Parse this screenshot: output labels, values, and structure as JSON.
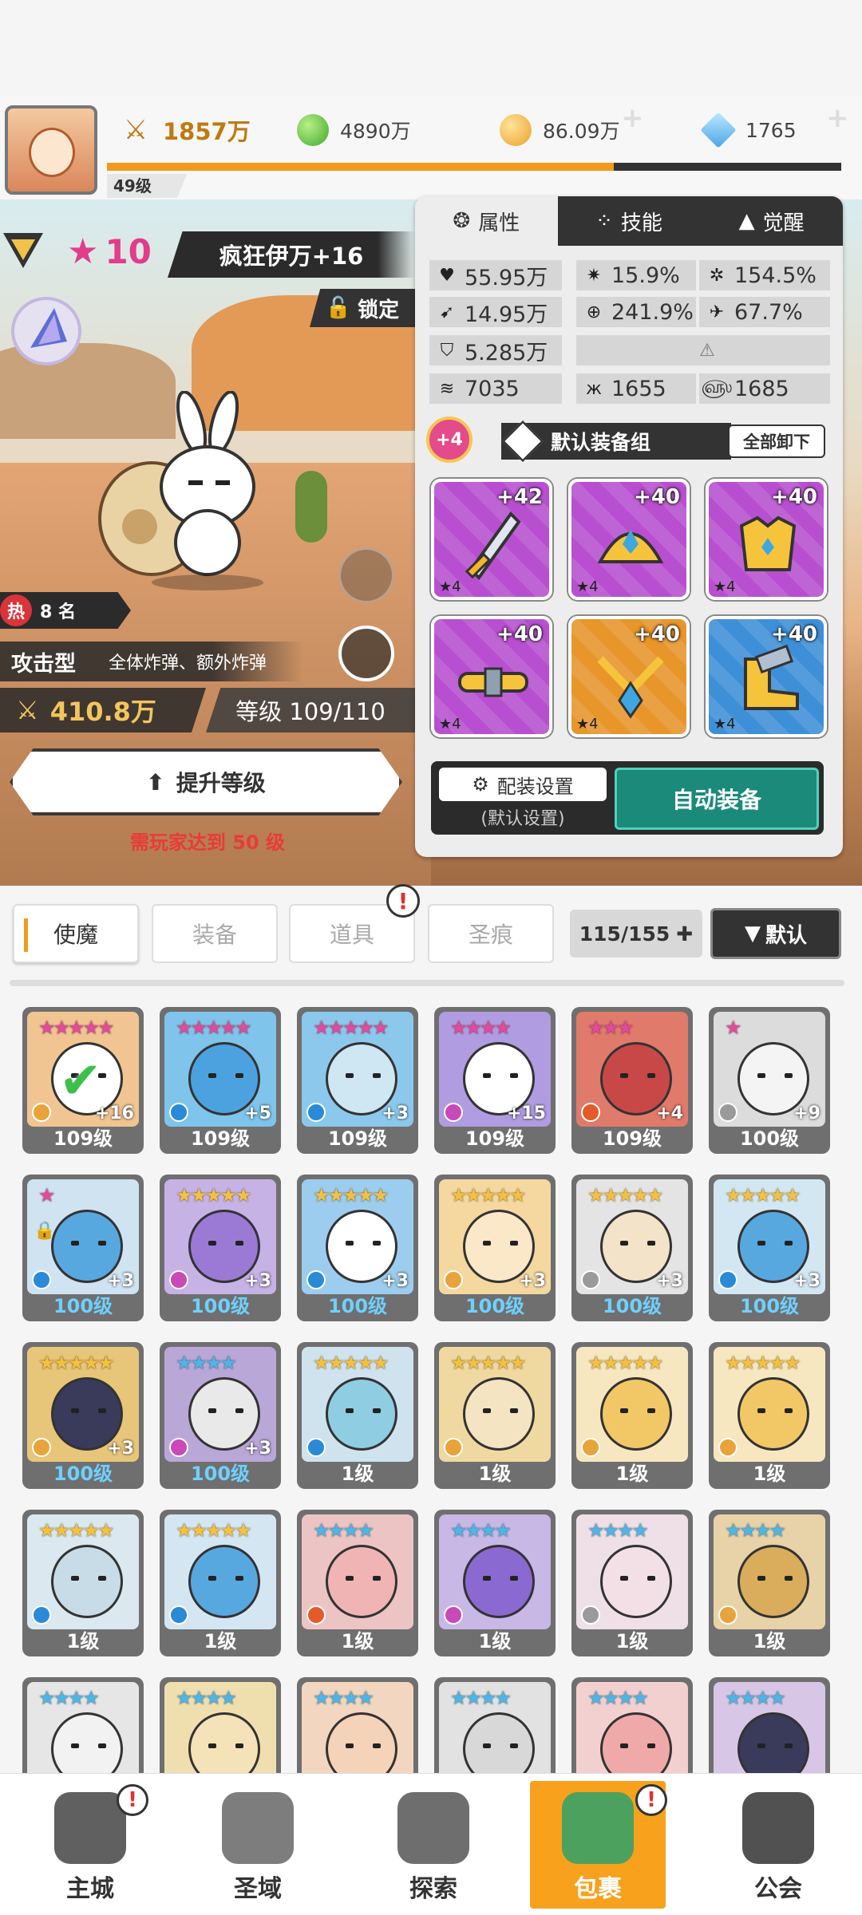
{
  "top": {
    "resources": [
      {
        "name": "power",
        "value": "1857万",
        "icon": "crossed-swords-icon"
      },
      {
        "name": "gold",
        "value": "4890万",
        "icon": "green-gem-icon"
      },
      {
        "name": "coin",
        "value": "86.09万",
        "icon": "gold-coin-icon"
      },
      {
        "name": "diamond",
        "value": "1765",
        "icon": "blue-crystal-icon"
      }
    ],
    "level": "49级",
    "xp_fraction": 0.69
  },
  "hero": {
    "star_count": "10",
    "name": "疯狂伊万+16",
    "lock_label": "锁定",
    "hot_label": "热",
    "hot_rank": "8 名",
    "type": "攻击型",
    "type_desc": "全体炸弹、额外炸弹",
    "power": "410.8万",
    "level": "等级 109/110",
    "upgrade_label": "提升等级",
    "requirement": "需玩家达到 50 级"
  },
  "panel": {
    "tabs": [
      "属性",
      "技能",
      "觉醒"
    ],
    "stats": [
      {
        "icon": "heart-icon",
        "value": "55.95万"
      },
      {
        "icon": "crit-icon",
        "value": "15.9%"
      },
      {
        "icon": "critdmg-icon",
        "value": "154.5%"
      },
      {
        "icon": "attack-icon",
        "value": "14.95万"
      },
      {
        "icon": "target-icon",
        "value": "241.9%"
      },
      {
        "icon": "speed-icon",
        "value": "67.7%"
      },
      {
        "icon": "shield-icon",
        "value": "5.285万"
      },
      {
        "icon": "wind-icon",
        "value": "7035"
      },
      {
        "icon": "dodge-icon",
        "value": "1655"
      },
      {
        "icon": "swirl-icon",
        "value": "1685"
      }
    ],
    "equip_badge": "+4",
    "equip_set": "默认装备组",
    "unequip_all": "全部卸下",
    "equipment": [
      {
        "plus": "+42",
        "stars": "★4",
        "kind": "sword",
        "color": "#b84fd0"
      },
      {
        "plus": "+40",
        "stars": "★4",
        "kind": "helmet",
        "color": "#b84fd0"
      },
      {
        "plus": "+40",
        "stars": "★4",
        "kind": "armor",
        "color": "#b84fd0"
      },
      {
        "plus": "+40",
        "stars": "★4",
        "kind": "belt",
        "color": "#b84fd0"
      },
      {
        "plus": "+40",
        "stars": "★4",
        "kind": "necklace",
        "color": "#e8952a"
      },
      {
        "plus": "+40",
        "stars": "★4",
        "kind": "boots",
        "color": "#3d8fd8"
      }
    ],
    "config_label": "配装设置",
    "config_sub": "(默认设置)",
    "auto_label": "自动装备"
  },
  "filter": {
    "tabs": [
      "使魔",
      "装备",
      "道具",
      "圣痕"
    ],
    "capacity": "115/155",
    "sort_label": "默认"
  },
  "cards": [
    {
      "stars": "★★★★★",
      "star_color": "#e6489a",
      "level": "109级",
      "plus": "+16",
      "bg": "#f1c591",
      "face": "#ffffff",
      "elem": "#e8a43a",
      "check": true
    },
    {
      "stars": "★★★★★",
      "star_color": "#e6489a",
      "level": "109级",
      "plus": "+5",
      "bg": "#7fc4ea",
      "face": "#4ca2de",
      "elem": "#2a8ad8"
    },
    {
      "stars": "★★★★★",
      "star_color": "#e6489a",
      "level": "109级",
      "plus": "+3",
      "bg": "#8cc8ec",
      "face": "#cfe6f3",
      "elem": "#2a8ad8"
    },
    {
      "stars": "★★★★",
      "star_color": "#e6489a",
      "level": "109级",
      "plus": "+15",
      "bg": "#b09ce0",
      "face": "#ffffff",
      "elem": "#c84ab8"
    },
    {
      "stars": "★★★",
      "star_color": "#e6489a",
      "level": "109级",
      "plus": "+4",
      "bg": "#e07a6a",
      "face": "#c84848",
      "elem": "#e55a2a"
    },
    {
      "stars": "★",
      "star_color": "#e6489a",
      "level": "100级",
      "plus": "+9",
      "bg": "#dcdcdc",
      "face": "#f4f4f4",
      "elem": "#9a9a9a"
    },
    {
      "stars": "★",
      "star_color": "#e6489a",
      "level": "100级",
      "plus": "+3",
      "bg": "#cfe3f0",
      "face": "#58a8e0",
      "elem": "#2a8ad8",
      "blue": true,
      "lock": true
    },
    {
      "stars": "★★★★★",
      "star_color": "#f6c13a",
      "level": "100级",
      "plus": "+3",
      "bg": "#c7b2e6",
      "face": "#9b7ad6",
      "elem": "#c84ab8",
      "blue": true
    },
    {
      "stars": "★★★★★",
      "star_color": "#f6c13a",
      "level": "100级",
      "plus": "+3",
      "bg": "#9ccdef",
      "face": "#ffffff",
      "elem": "#2a8ad8",
      "blue": true
    },
    {
      "stars": "★★★★★",
      "star_color": "#f6c13a",
      "level": "100级",
      "plus": "+3",
      "bg": "#f4d8a0",
      "face": "#fbe8c8",
      "elem": "#e8a43a",
      "blue": true
    },
    {
      "stars": "★★★★★",
      "star_color": "#f6c13a",
      "level": "100级",
      "plus": "+3",
      "bg": "#e4e4e4",
      "face": "#f3e3c8",
      "elem": "#9a9a9a",
      "blue": true
    },
    {
      "stars": "★★★★★",
      "star_color": "#f6c13a",
      "level": "100级",
      "plus": "+3",
      "bg": "#d3e7f3",
      "face": "#58a8e0",
      "elem": "#2a8ad8",
      "blue": true
    },
    {
      "stars": "★★★★★",
      "star_color": "#f6c13a",
      "level": "100级",
      "plus": "+3",
      "bg": "#e7c67a",
      "face": "#3a3b5a",
      "elem": "#e8a43a",
      "blue": true
    },
    {
      "stars": "★★★★",
      "star_color": "#4cb6e8",
      "level": "100级",
      "plus": "+3",
      "bg": "#b9a7d8",
      "face": "#e9e9e9",
      "elem": "#c84ab8",
      "blue": true
    },
    {
      "stars": "★★★★★",
      "star_color": "#f6c13a",
      "level": "1级",
      "plus": "",
      "bg": "#cfe3ef",
      "face": "#8fcde2",
      "elem": "#2a8ad8"
    },
    {
      "stars": "★★★★★",
      "star_color": "#f6c13a",
      "level": "1级",
      "plus": "",
      "bg": "#f0d9a0",
      "face": "#f4e4c2",
      "elem": "#e8a43a"
    },
    {
      "stars": "★★★★★",
      "star_color": "#f6c13a",
      "level": "1级",
      "plus": "",
      "bg": "#f6e7c0",
      "face": "#f2c866",
      "elem": "#e8a43a"
    },
    {
      "stars": "★★★★★",
      "star_color": "#f6c13a",
      "level": "1级",
      "plus": "",
      "bg": "#f6e7c0",
      "face": "#f2c866",
      "elem": "#e8a43a"
    },
    {
      "stars": "★★★★★",
      "star_color": "#f6c13a",
      "level": "1级",
      "plus": "",
      "bg": "#dbe8ef",
      "face": "#c7dce6",
      "elem": "#2a8ad8"
    },
    {
      "stars": "★★★★★",
      "star_color": "#f6c13a",
      "level": "1级",
      "plus": "",
      "bg": "#d5e6f3",
      "face": "#58a8e0",
      "elem": "#2a8ad8"
    },
    {
      "stars": "★★★★",
      "star_color": "#4cb6e8",
      "level": "1级",
      "plus": "",
      "bg": "#ecc4c4",
      "face": "#f0b4b4",
      "elem": "#e55a2a"
    },
    {
      "stars": "★★★★",
      "star_color": "#4cb6e8",
      "level": "1级",
      "plus": "",
      "bg": "#c7b8e6",
      "face": "#8a6ad0",
      "elem": "#c84ab8"
    },
    {
      "stars": "★★★★",
      "star_color": "#4cb6e8",
      "level": "1级",
      "plus": "",
      "bg": "#efe0e8",
      "face": "#f3e0e6",
      "elem": "#9a9a9a"
    },
    {
      "stars": "★★★★",
      "star_color": "#4cb6e8",
      "level": "1级",
      "plus": "",
      "bg": "#e8d2a8",
      "face": "#d9ad5c",
      "elem": "#e8a43a"
    },
    {
      "stars": "★★★★",
      "star_color": "#4cb6e8",
      "level": "",
      "plus": "",
      "bg": "#e6e6e6",
      "face": "#f2f2f2",
      "elem": "#9a9a9a"
    },
    {
      "stars": "★★★★",
      "star_color": "#4cb6e8",
      "level": "",
      "plus": "",
      "bg": "#f0dfae",
      "face": "#f4e2b8",
      "elem": "#e8a43a"
    },
    {
      "stars": "★★★★",
      "star_color": "#4cb6e8",
      "level": "",
      "plus": "",
      "bg": "#f2d6c0",
      "face": "#f4d3b8",
      "elem": "#e55a2a"
    },
    {
      "stars": "★★★★",
      "star_color": "#4cb6e8",
      "level": "",
      "plus": "",
      "bg": "#e2e2e2",
      "face": "#d8d8d8",
      "elem": "#9a9a9a"
    },
    {
      "stars": "★★★★",
      "star_color": "#4cb6e8",
      "level": "",
      "plus": "",
      "bg": "#f3d0d0",
      "face": "#f0a9a9",
      "elem": "#e55a2a"
    },
    {
      "stars": "★★★★",
      "star_color": "#4cb6e8",
      "level": "",
      "plus": "",
      "bg": "#d8c6e6",
      "face": "#3a3b5a",
      "elem": "#c84ab8"
    }
  ],
  "nav": {
    "items": [
      {
        "label": "主城",
        "icon": "castle-icon"
      },
      {
        "label": "圣域",
        "icon": "vortex-icon"
      },
      {
        "label": "探索",
        "icon": "sword-stone-icon"
      },
      {
        "label": "包裹",
        "icon": "backpack-icon"
      },
      {
        "label": "公会",
        "icon": "guild-icon"
      }
    ],
    "active_index": 3
  },
  "alerts": {
    "mark": "!"
  }
}
